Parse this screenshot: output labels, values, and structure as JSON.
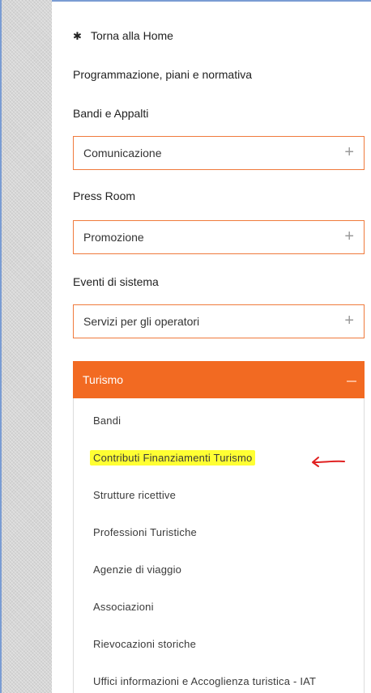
{
  "menu": {
    "home_label": "Torna alla Home",
    "items": [
      {
        "label": "Programmazione, piani e normativa"
      },
      {
        "label": "Bandi e Appalti"
      },
      {
        "label": "Comunicazione",
        "expand": "+"
      },
      {
        "label": "Press Room"
      },
      {
        "label": "Promozione",
        "expand": "+"
      },
      {
        "label": "Eventi di sistema"
      },
      {
        "label": "Servizi per gli operatori",
        "expand": "+"
      }
    ],
    "active": {
      "label": "Turismo",
      "submenu": [
        {
          "label": "Bandi"
        },
        {
          "label": "Contributi Finanziamenti Turismo",
          "highlighted": true
        },
        {
          "label": "Strutture ricettive"
        },
        {
          "label": "Professioni Turistiche"
        },
        {
          "label": "Agenzie di viaggio"
        },
        {
          "label": "Associazioni"
        },
        {
          "label": "Rievocazioni storiche"
        },
        {
          "label": "Uffici informazioni e Accoglienza turistica - IAT"
        }
      ]
    }
  },
  "colors": {
    "accent": "#f26a22",
    "border": "#f07a3c",
    "highlight": "#ffff33",
    "annotation_arrow": "#e02020"
  },
  "icons": {
    "home": "home-icon",
    "expand": "plus-icon",
    "collapse": "minus-icon",
    "annotation": "red-arrow-icon"
  }
}
